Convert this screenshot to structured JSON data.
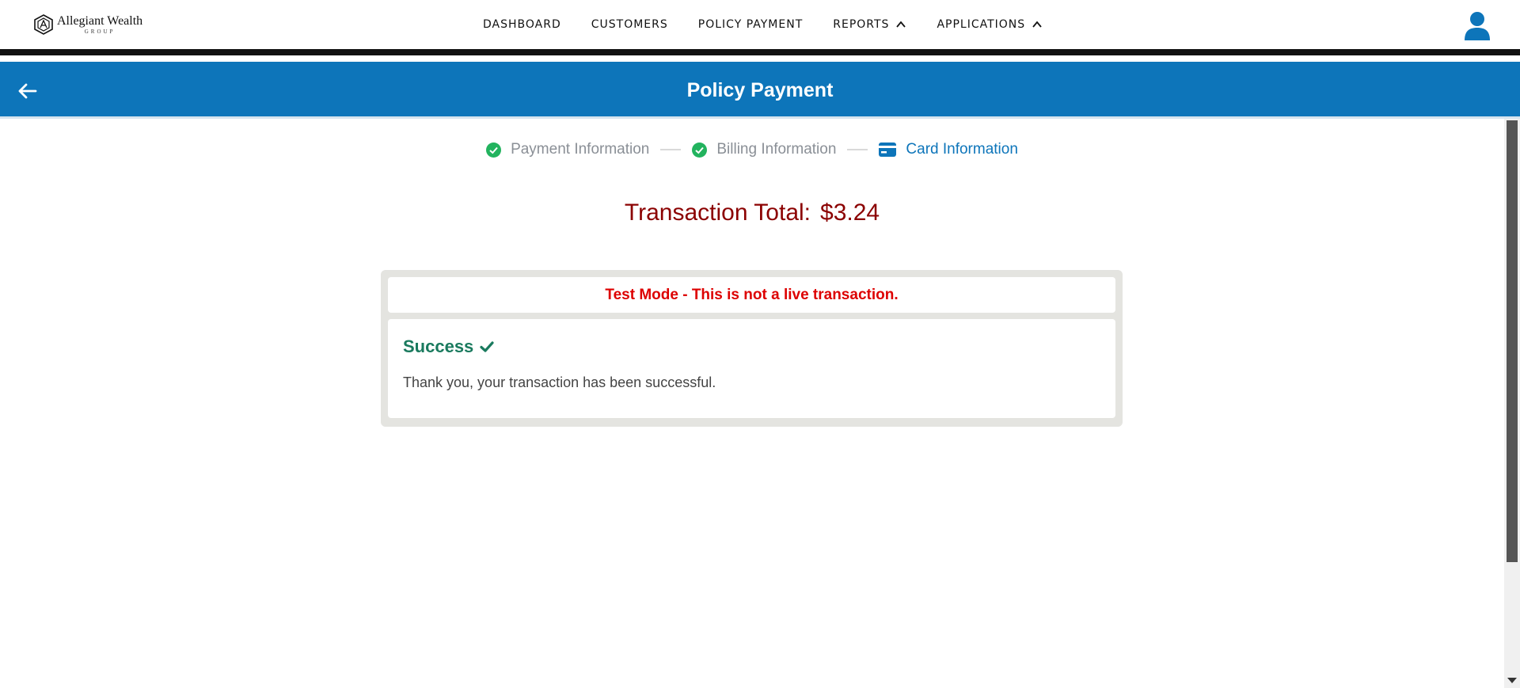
{
  "brand": {
    "name": "Allegiant Wealth",
    "sub": "GROUP"
  },
  "nav": {
    "items": [
      {
        "label": "DASHBOARD",
        "has_chevron": false
      },
      {
        "label": "CUSTOMERS",
        "has_chevron": false
      },
      {
        "label": "POLICY PAYMENT",
        "has_chevron": false
      },
      {
        "label": "REPORTS",
        "has_chevron": true
      },
      {
        "label": "APPLICATIONS",
        "has_chevron": true
      }
    ]
  },
  "header": {
    "title": "Policy Payment",
    "back_icon": "arrow-left-icon"
  },
  "stepper": {
    "steps": [
      {
        "label": "Payment Information",
        "state": "complete",
        "icon": "check-circle-icon"
      },
      {
        "label": "Billing Information",
        "state": "complete",
        "icon": "check-circle-icon"
      },
      {
        "label": "Card Information",
        "state": "active",
        "icon": "credit-card-icon"
      }
    ]
  },
  "transaction": {
    "label": "Transaction Total:",
    "amount": "$3.24"
  },
  "notice": {
    "test_mode": "Test Mode - This is not a live transaction."
  },
  "result": {
    "title": "Success",
    "message": "Thank you, your transaction has been successful."
  },
  "colors": {
    "primary": "#0d75ba",
    "success": "#1a7a5e",
    "step_check": "#22b35e",
    "total": "#8b0000",
    "warning": "#dd0000"
  }
}
